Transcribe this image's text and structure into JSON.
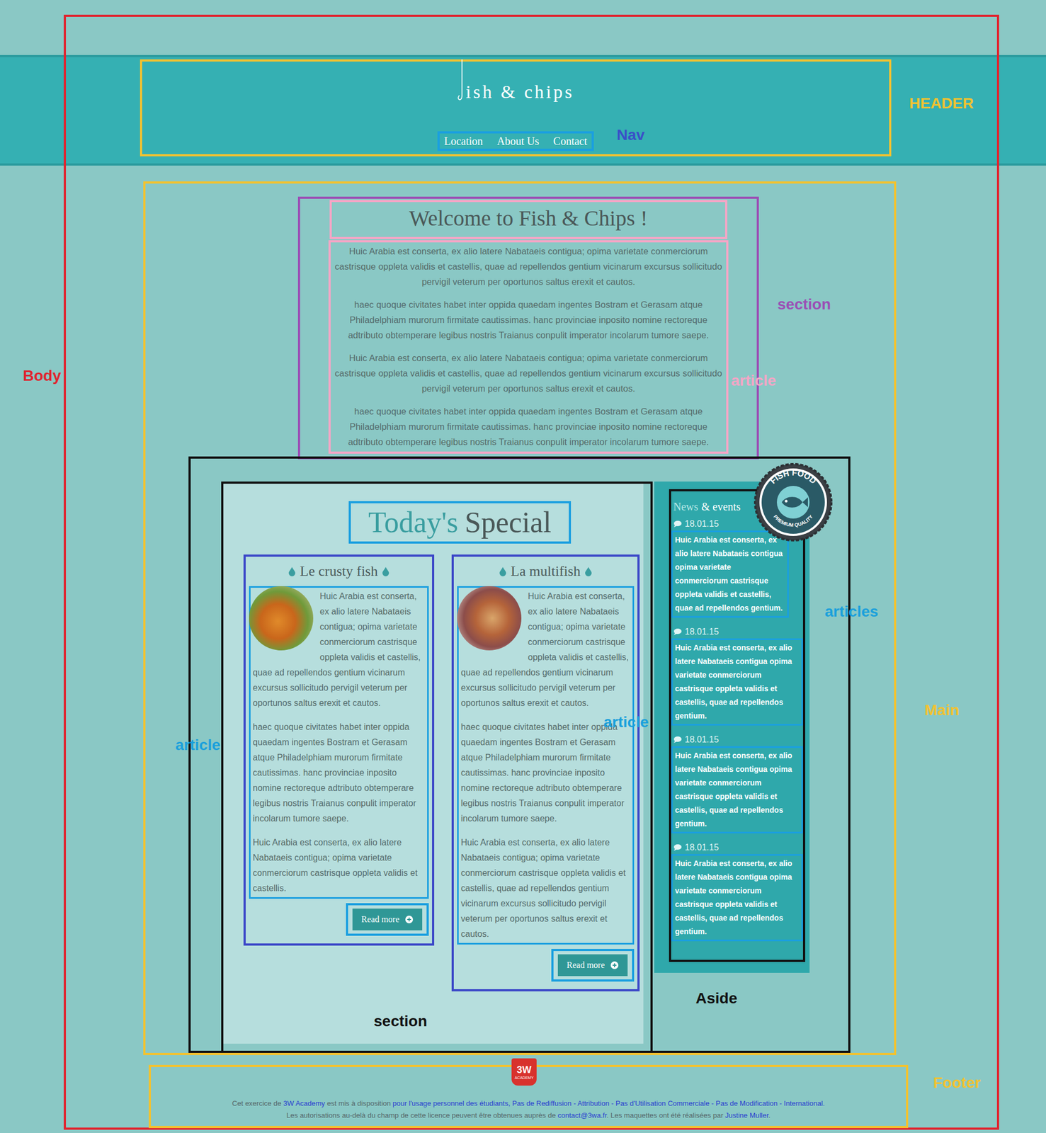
{
  "annotations": [
    {
      "text": "HEADER",
      "color": "#f2c230"
    },
    {
      "text": "Nav",
      "color": "#3a4fc8"
    },
    {
      "text": "section",
      "color": "#9b4fb5"
    },
    {
      "text": "article",
      "color": "#f4a6c6"
    },
    {
      "text": "Body",
      "color": "#e0242f"
    },
    {
      "text": "Main",
      "color": "#f2c230"
    },
    {
      "text": "Footer",
      "color": "#f2c230"
    },
    {
      "text": "articles",
      "color": "#1aa0dc"
    },
    {
      "text": "article",
      "color": "#1aa0dc"
    },
    {
      "text": "article",
      "color": "#1aa0dc"
    },
    {
      "text": "section",
      "color": "#111111"
    },
    {
      "text": "Aside",
      "color": "#111111"
    }
  ],
  "header": {
    "logo": "ish & chips",
    "nav": [
      "Location",
      "About Us",
      "Contact"
    ]
  },
  "welcome": {
    "title": "Welcome to Fish & Chips !",
    "paragraphs": [
      "Huic Arabia est conserta, ex alio latere Nabataeis contigua; opima varietate conmerciorum castrisque oppleta validis et castellis, quae ad repellendos gentium vicinarum excursus sollicitudo pervigil veterum per oportunos saltus erexit et cautos.",
      "haec quoque civitates habet inter oppida quaedam ingentes Bostram et Gerasam atque Philadelphiam murorum firmitate cautissimas. hanc provinciae inposito nomine rectoreque adtributo obtemperare legibus nostris Traianus conpulit imperator incolarum tumore saepe.",
      "Huic Arabia est conserta, ex alio latere Nabataeis contigua; opima varietate conmerciorum castrisque oppleta validis et castellis, quae ad repellendos gentium vicinarum excursus sollicitudo pervigil veterum per oportunos saltus erexit et cautos.",
      "haec quoque civitates habet inter oppida quaedam ingentes Bostram et Gerasam atque Philadelphiam murorum firmitate cautissimas. hanc provinciae inposito nomine rectoreque adtributo obtemperare legibus nostris Traianus conpulit imperator incolarum tumore saepe."
    ]
  },
  "special": {
    "title_accent": "Today's",
    "title_rest": "Special",
    "articles": [
      {
        "title": "Le crusty fish",
        "paragraphs": [
          "Huic Arabia est conserta, ex alio latere Nabataeis contigua; opima varietate conmerciorum castrisque oppleta validis et castellis, quae ad repellendos gentium vicinarum excursus sollicitudo pervigil veterum per oportunos saltus erexit et cautos.",
          "haec quoque civitates habet inter oppida quaedam ingentes Bostram et Gerasam atque Philadelphiam murorum firmitate cautissimas. hanc provinciae inposito nomine rectoreque adtributo obtemperare legibus nostris Traianus conpulit imperator incolarum tumore saepe.",
          "Huic Arabia est conserta, ex alio latere Nabataeis contigua; opima varietate conmerciorum castrisque oppleta validis et castellis."
        ],
        "button": "Read more"
      },
      {
        "title": "La multifish",
        "paragraphs": [
          "Huic Arabia est conserta, ex alio latere Nabataeis contigua; opima varietate conmerciorum castrisque oppleta validis et castellis, quae ad repellendos gentium vicinarum excursus sollicitudo pervigil veterum per oportunos saltus erexit et cautos.",
          "haec quoque civitates habet inter oppida quaedam ingentes Bostram et Gerasam atque Philadelphiam murorum firmitate cautissimas. hanc provinciae inposito nomine rectoreque adtributo obtemperare legibus nostris Traianus conpulit imperator incolarum tumore saepe.",
          "Huic Arabia est conserta, ex alio latere Nabataeis contigua; opima varietate conmerciorum castrisque oppleta validis et castellis, quae ad repellendos gentium vicinarum excursus sollicitudo pervigil veterum per oportunos saltus erexit et cautos."
        ],
        "button": "Read more"
      }
    ]
  },
  "aside": {
    "title_accent": "News",
    "title_rest": "& events",
    "items": [
      {
        "date": "18.01.15",
        "text": "Huic Arabia est conserta, ex alio latere Nabataeis contigua opima varietate conmerciorum castrisque oppleta validis et castellis, quae ad repellendos gentium."
      },
      {
        "date": "18.01.15",
        "text": "Huic Arabia est conserta, ex alio latere Nabataeis contigua opima varietate conmerciorum castrisque oppleta validis et castellis, quae ad repellendos gentium."
      },
      {
        "date": "18.01.15",
        "text": "Huic Arabia est conserta, ex alio latere Nabataeis contigua opima varietate conmerciorum castrisque oppleta validis et castellis, quae ad repellendos gentium."
      },
      {
        "date": "18.01.15",
        "text": "Huic Arabia est conserta, ex alio latere Nabataeis contigua opima varietate conmerciorum castrisque oppleta validis et castellis, quae ad repellendos gentium."
      }
    ]
  },
  "badge": {
    "top": "FISH FOOD",
    "bottom": "PREMIUM QUALITY"
  },
  "footer": {
    "logo_main": "3W",
    "logo_sub": "ACADEMY",
    "lines": [
      [
        {
          "text": "Cet exercice de ",
          "link": false
        },
        {
          "text": "3W Academy",
          "link": true
        },
        {
          "text": " est mis à disposition ",
          "link": false
        },
        {
          "text": "pour l'usage personnel des étudiants, Pas de Rediffusion - Attribution - Pas d'Utilisation Commerciale - Pas de Modification - International.",
          "link": true
        }
      ],
      [
        {
          "text": "Les autorisations au-delà du champ de cette licence peuvent être obtenues auprès de ",
          "link": false
        },
        {
          "text": "contact@3wa.fr",
          "link": true
        },
        {
          "text": ". Les maquettes ont été réalisées par ",
          "link": false
        },
        {
          "text": "Justine Muller",
          "link": true
        },
        {
          "text": ".",
          "link": false
        }
      ]
    ]
  }
}
